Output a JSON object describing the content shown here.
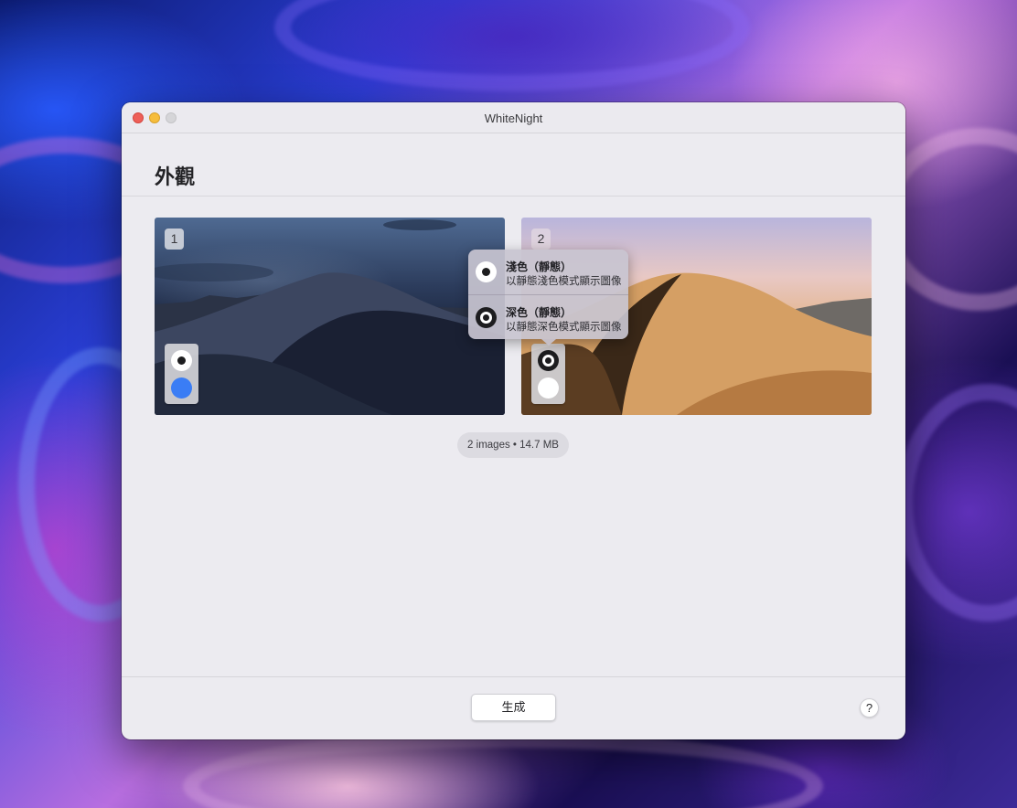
{
  "window": {
    "title": "WhiteNight"
  },
  "page": {
    "title": "外觀"
  },
  "images": [
    {
      "index": "1",
      "selected_mode": "light"
    },
    {
      "index": "2",
      "selected_mode": "dark"
    }
  ],
  "popover": {
    "items": [
      {
        "title": "淺色（靜態）",
        "subtitle": "以靜態淺色模式顯示圖像"
      },
      {
        "title": "深色（靜態）",
        "subtitle": "以靜態深色模式顯示圖像"
      }
    ]
  },
  "info": {
    "summary": "2 images • 14.7 MB"
  },
  "footer": {
    "generate_label": "生成",
    "help_label": "?"
  },
  "colors": {
    "accent": "#3a7df5",
    "close": "#ee5f58",
    "minimize": "#f6bd3c",
    "zoom": "#d5d5d8"
  }
}
